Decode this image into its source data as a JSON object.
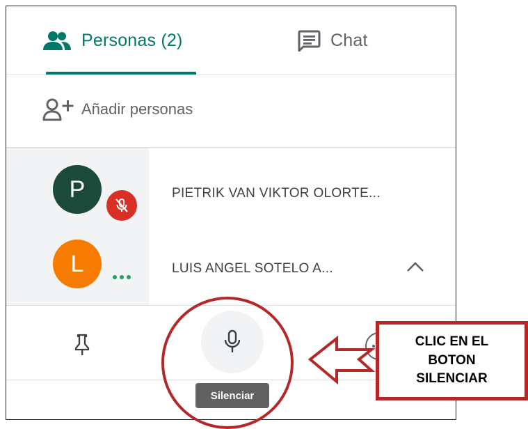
{
  "tabs": {
    "people_label": "Personas (2)",
    "chat_label": "Chat"
  },
  "add_people_label": "Añadir personas",
  "participants": [
    {
      "initial": "P",
      "name": "PIETRIK VAN VIKTOR OLORTE...",
      "avatar_color": "#1b4a3a",
      "muted": true
    },
    {
      "initial": "L",
      "name": "LUIS ANGEL SOTELO A...",
      "avatar_color": "#f57c00",
      "muted": false
    }
  ],
  "controls": {
    "mute_tooltip": "Silenciar"
  },
  "annotation": {
    "line1": "CLIC EN EL",
    "line2": "BOTON",
    "line3": "SILENCIAR",
    "color": "#b52828"
  },
  "colors": {
    "accent": "#00796b",
    "muted_badge": "#d93025",
    "talking_dots": "#1aa260"
  }
}
